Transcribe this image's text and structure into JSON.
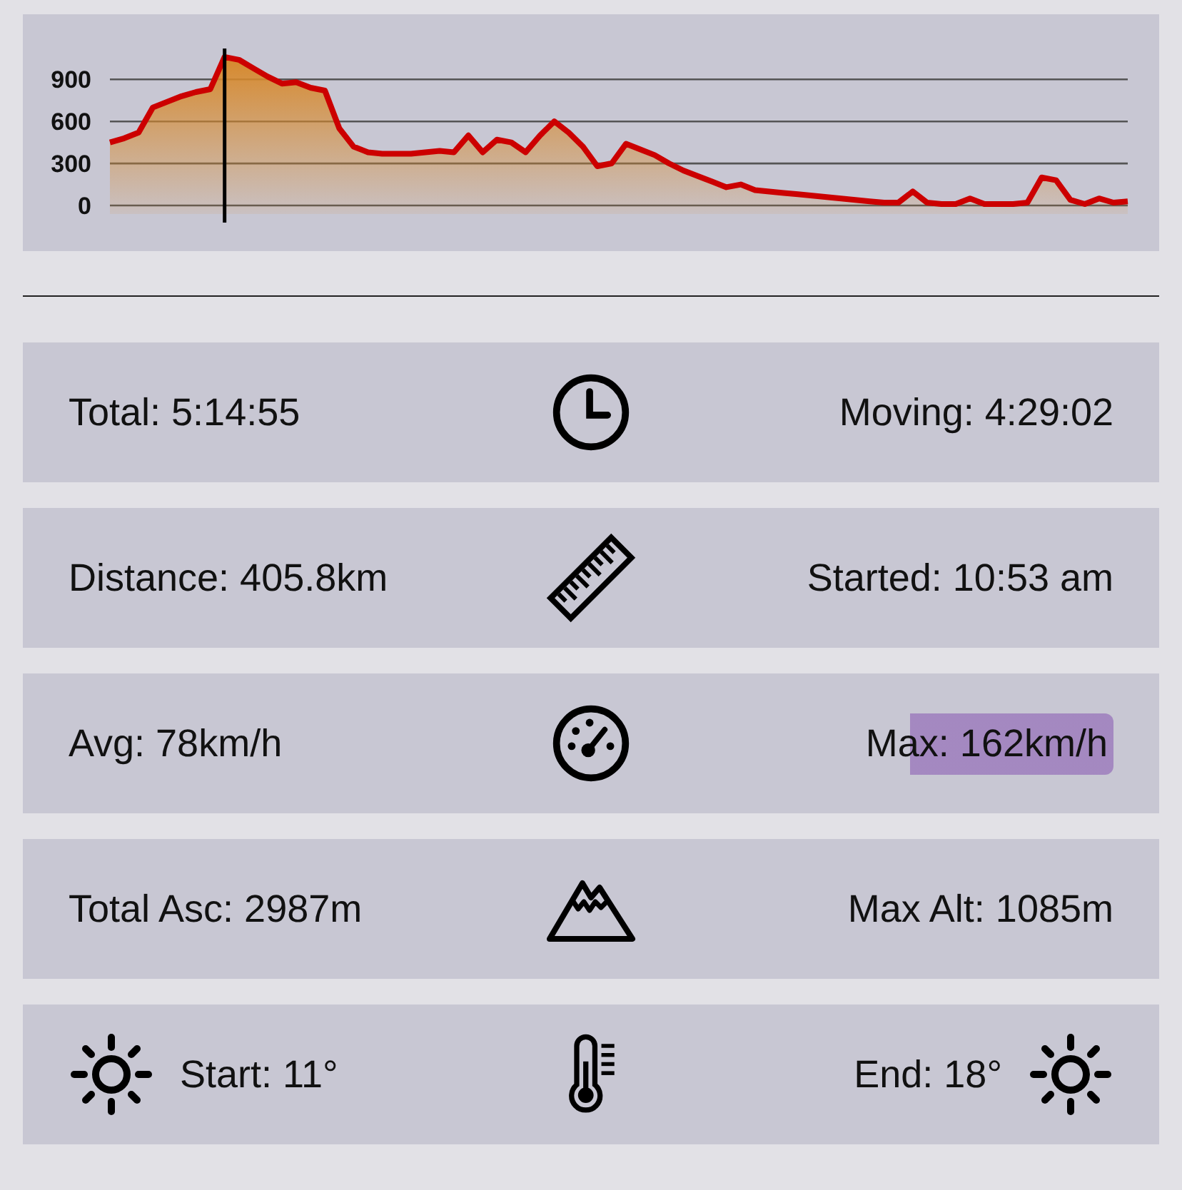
{
  "elevation": {
    "chart_data": {
      "type": "area",
      "grid": true,
      "yticks": [
        0,
        300,
        600,
        900
      ],
      "ylim": [
        0,
        1100
      ],
      "values": [
        450,
        480,
        520,
        700,
        740,
        780,
        810,
        830,
        1060,
        1040,
        980,
        920,
        870,
        880,
        840,
        820,
        550,
        420,
        380,
        370,
        370,
        370,
        380,
        390,
        380,
        500,
        380,
        470,
        450,
        380,
        500,
        600,
        520,
        420,
        280,
        300,
        440,
        400,
        360,
        300,
        250,
        210,
        170,
        130,
        150,
        110,
        100,
        90,
        80,
        70,
        60,
        50,
        40,
        30,
        20,
        20,
        100,
        20,
        10,
        10,
        50,
        10,
        10,
        10,
        20,
        200,
        180,
        40,
        10,
        50,
        20,
        30
      ]
    }
  },
  "stats": [
    {
      "kind": "clock",
      "sun_icons": false,
      "left_text": "Total: 5:14:55",
      "right_text": "Moving: 4:29:02",
      "scribbled": false
    },
    {
      "kind": "ruler",
      "sun_icons": false,
      "left_text": "Distance: 405.8km",
      "right_text": "Started: 10:53 am",
      "scribbled": false
    },
    {
      "kind": "speedometer",
      "sun_icons": false,
      "left_text": "Avg: 78km/h",
      "right_text": "Max: 162km/h",
      "scribbled": true
    },
    {
      "kind": "mountain",
      "sun_icons": false,
      "left_text": "Total Asc: 2987m",
      "right_text": "Max Alt: 1085m",
      "scribbled": false
    },
    {
      "kind": "thermometer",
      "sun_icons": true,
      "left_text": "Start: 11°",
      "right_text": "End: 18°",
      "scribbled": false
    }
  ]
}
